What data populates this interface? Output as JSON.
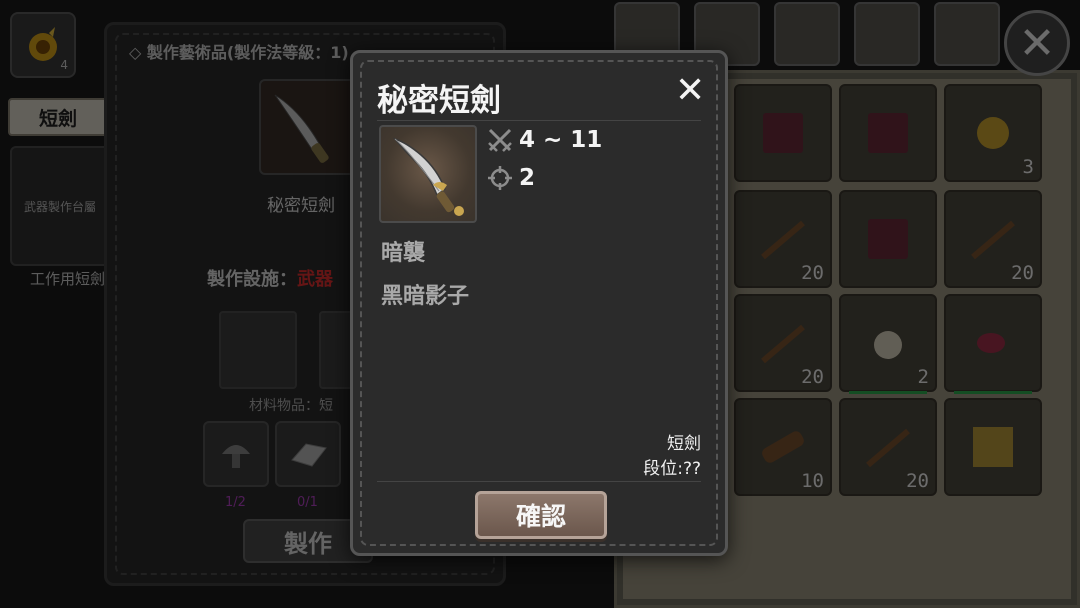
{
  "top_bar": {
    "skill_slot_count": "4"
  },
  "left": {
    "category_tab": "短劍",
    "recipe_facility": "武器製作台屬",
    "recipe_name": "工作用短劍"
  },
  "craft_panel": {
    "title": "製作藝術品(製作法等級：1)",
    "item_name": "秘密短劍",
    "facility_label": "製作設施：",
    "facility_value": "武器",
    "materials_label": "材料物品：短",
    "ingredients": [
      {
        "icon": "mushroom-icon",
        "count": "1/2"
      },
      {
        "icon": "ingot-icon",
        "count": "0/1"
      }
    ],
    "craft_button": "製作"
  },
  "inventory": {
    "tabs": [
      "backpack-icon",
      "chest-icon",
      "box-icon",
      "bag-icon",
      "horse-icon"
    ],
    "slots": [
      {
        "icon": "book-icon",
        "count": ""
      },
      {
        "icon": "book-icon",
        "count": ""
      },
      {
        "icon": "coin-icon",
        "count": "3"
      },
      {
        "icon": "branch-icon",
        "count": "20"
      },
      {
        "icon": "book-icon",
        "count": ""
      },
      {
        "icon": "branch-icon",
        "count": "20"
      },
      {
        "icon": "branch-icon",
        "count": "20"
      },
      {
        "icon": "garlic-icon",
        "count": "2"
      },
      {
        "icon": "meat-icon",
        "count": ""
      },
      {
        "icon": "log-icon",
        "count": "10"
      },
      {
        "icon": "branch-icon",
        "count": "20"
      },
      {
        "icon": "map-icon",
        "count": ""
      }
    ]
  },
  "modal": {
    "title": "秘密短劍",
    "attack": "4 ~ 11",
    "accuracy": "2",
    "skill_1": "暗襲",
    "skill_2": "黑暗影子",
    "weapon_type": "短劍",
    "rank": "段位:??",
    "confirm_label": "確認"
  },
  "colors": {
    "facility_red": "#e03030",
    "durability_green": "#2eaa4e",
    "ingredient_count": "#b040c0"
  }
}
